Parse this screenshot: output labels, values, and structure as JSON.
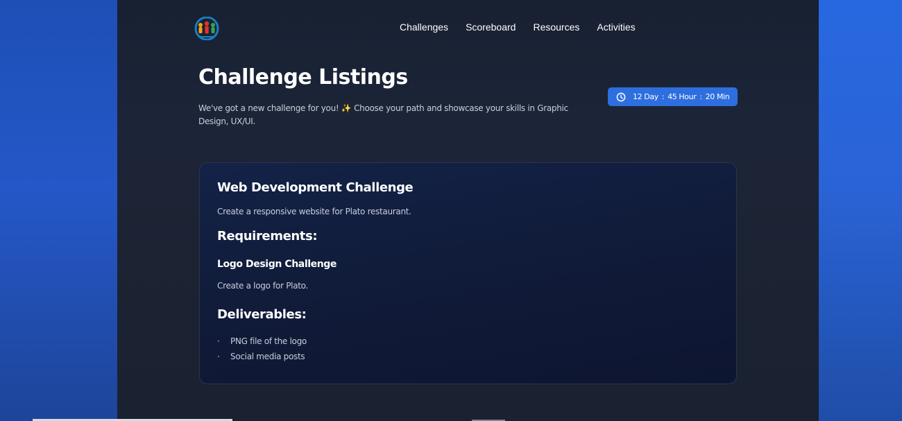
{
  "nav": {
    "items": [
      {
        "label": "Challenges"
      },
      {
        "label": "Scoreboard"
      },
      {
        "label": "Resources"
      },
      {
        "label": "Activities"
      }
    ]
  },
  "logo": {
    "icon": "people-logo-icon"
  },
  "header": {
    "title": "Challenge Listings",
    "subtitle": "We've got a new challenge for you! ✨ Choose your path and showcase your skills in Graphic Design, UX/UI."
  },
  "timer": {
    "icon": "clock-icon",
    "day": "12 Day",
    "hour": "45 Hour",
    "min": "20 Min",
    "separator": ":"
  },
  "card": {
    "title": "Web Development Challenge",
    "description": "Create a responsive website for Plato restaurant.",
    "requirements_heading": "Requirements:",
    "sub_challenge_title": "Logo Design Challenge",
    "sub_challenge_description": "Create a logo for Plato.",
    "deliverables_heading": "Deliverables:",
    "deliverables": [
      {
        "bullet": "·",
        "text": "PNG file of the logo"
      },
      {
        "bullet": "·",
        "text": "Social media posts"
      }
    ]
  },
  "colors": {
    "accent": "#2e6fdf",
    "page_bg": "#1c2538",
    "card_bg": "#111c3a",
    "side_bg": "#2a63d6"
  }
}
